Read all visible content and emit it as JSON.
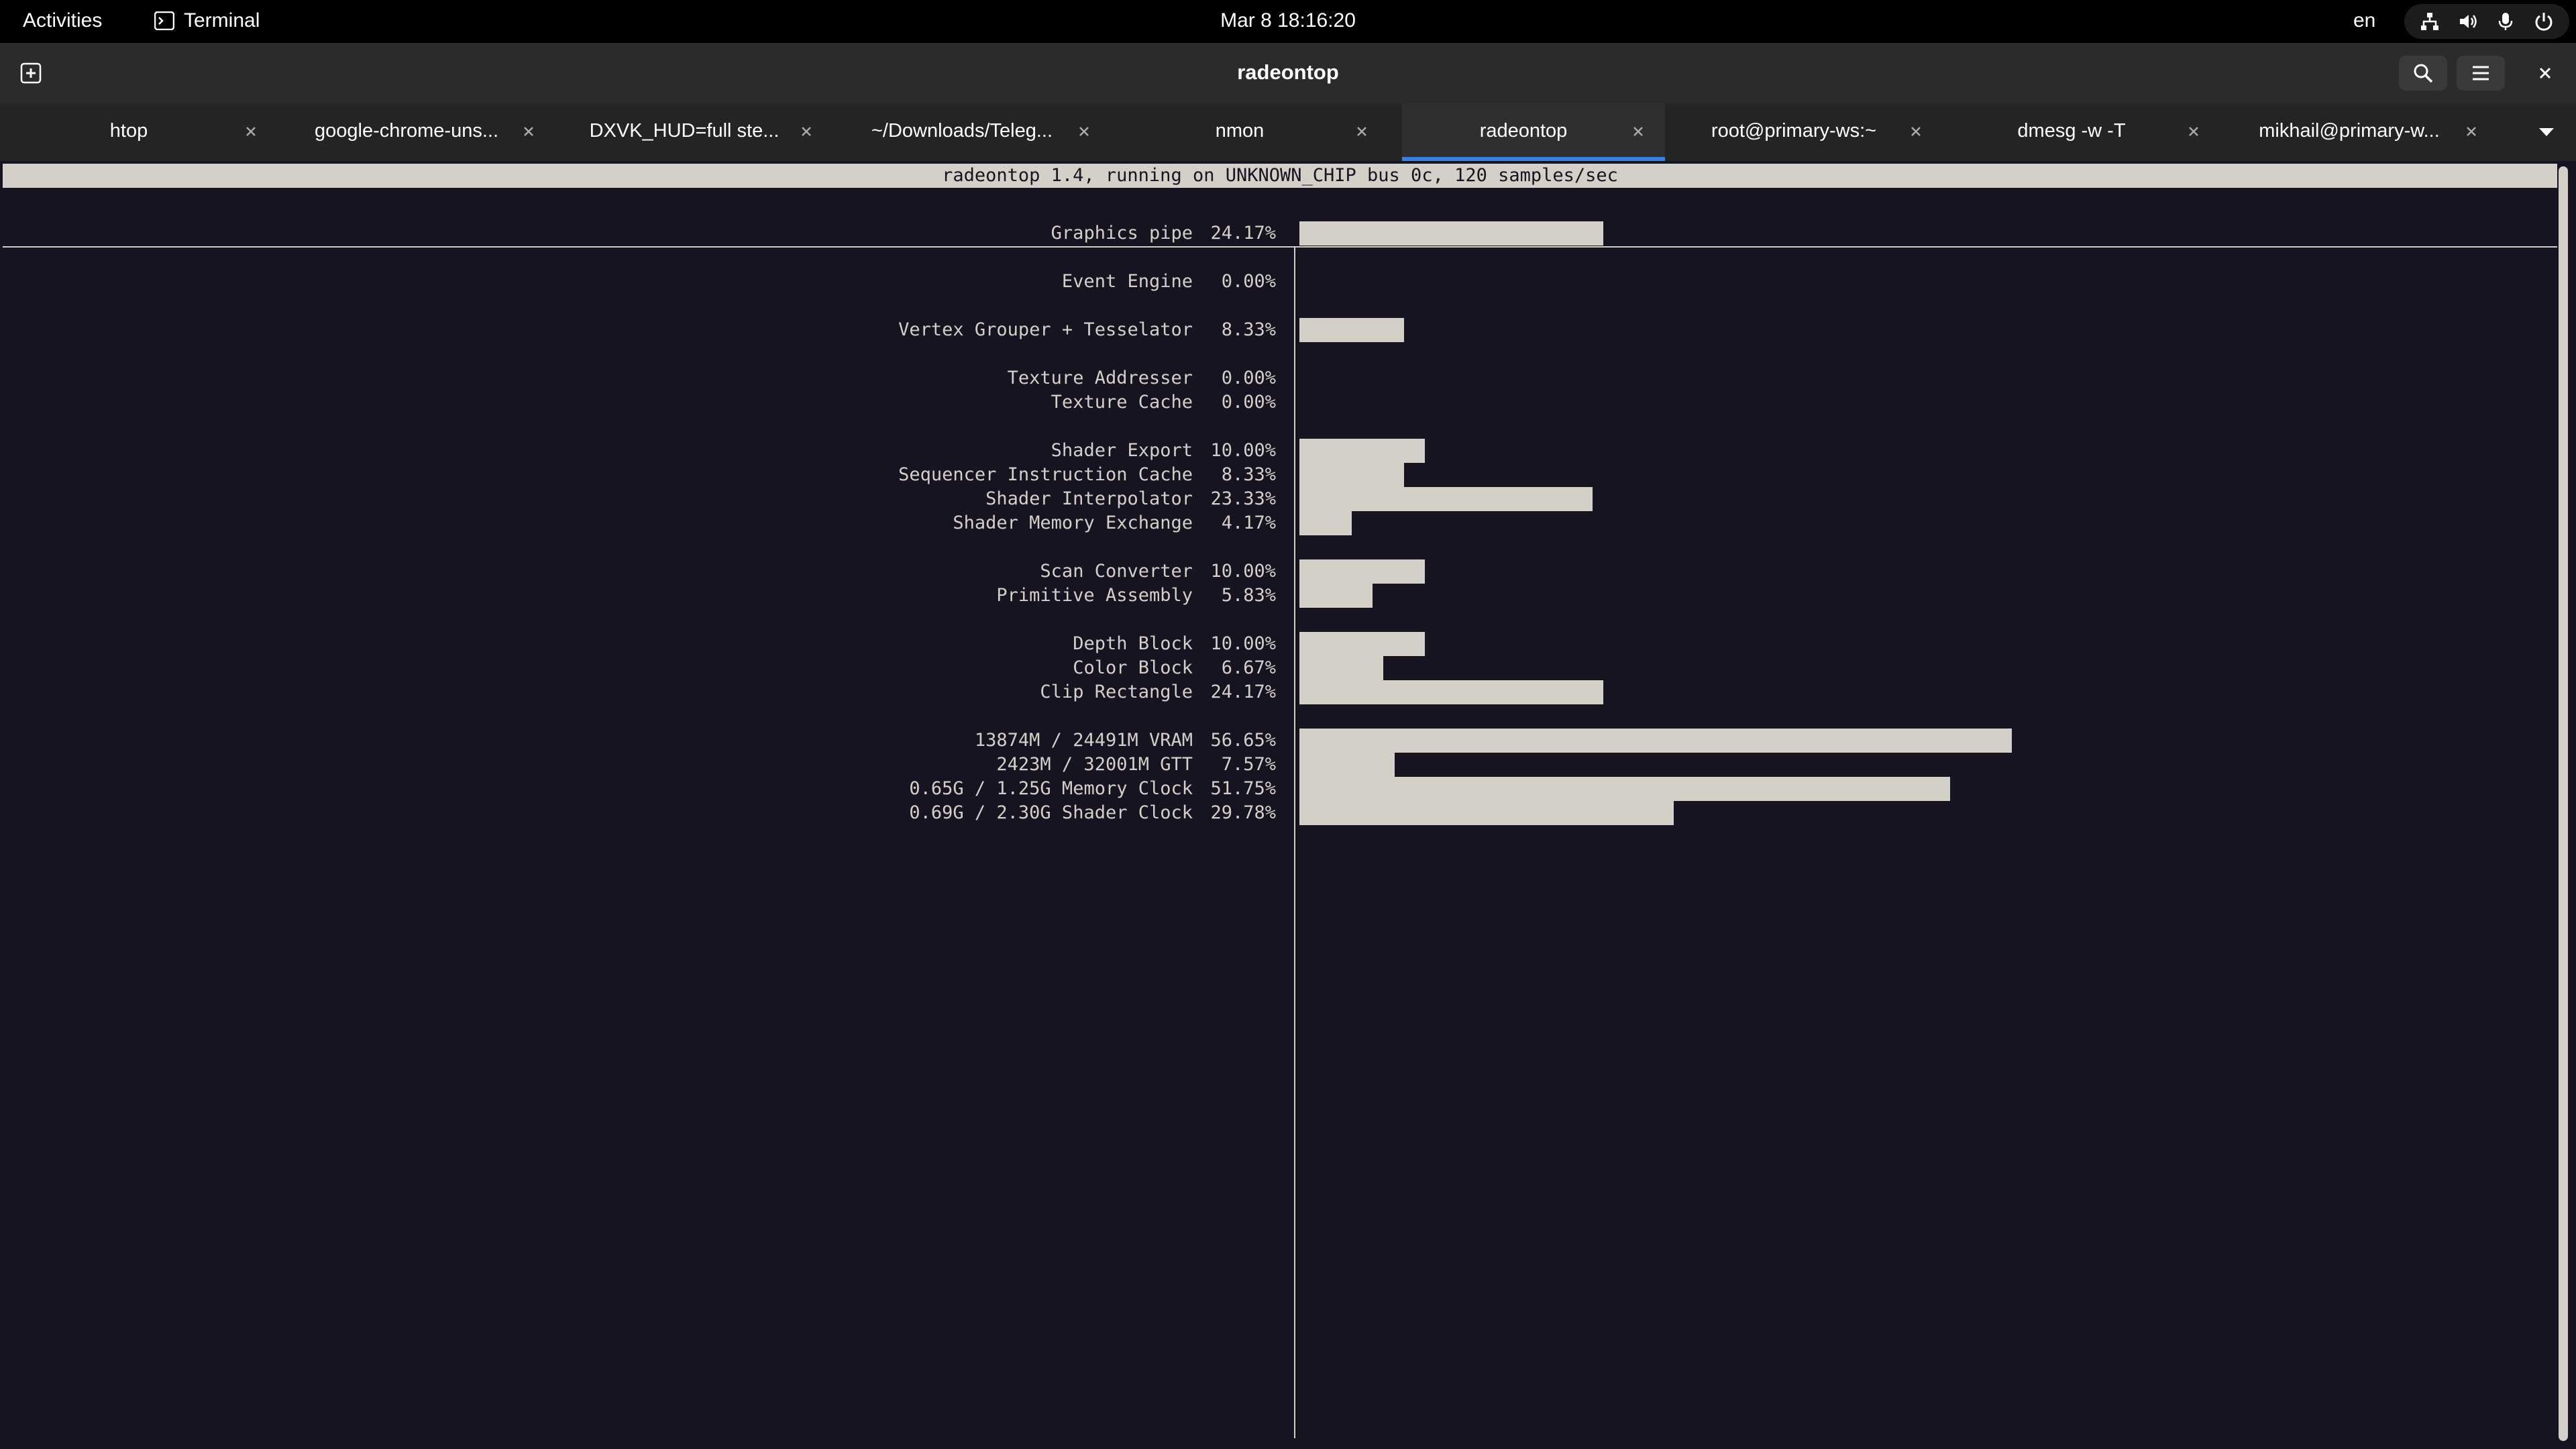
{
  "topbar": {
    "activities": "Activities",
    "app_name": "Terminal",
    "clock": "Mar 8  18:16:20",
    "language": "en",
    "status_icons": [
      "network-icon",
      "volume-icon",
      "microphone-icon",
      "power-icon"
    ]
  },
  "headerbar": {
    "title": "radeontop",
    "buttons": [
      "new-tab-icon",
      "search-icon",
      "hamburger-menu-icon",
      "close-icon"
    ]
  },
  "tabs": [
    {
      "label": "htop",
      "active": false
    },
    {
      "label": "google-chrome-uns...",
      "active": false
    },
    {
      "label": "DXVK_HUD=full ste...",
      "active": false
    },
    {
      "label": "~/Downloads/Teleg...",
      "active": false
    },
    {
      "label": "nmon",
      "active": false
    },
    {
      "label": "radeontop",
      "active": true
    },
    {
      "label": "root@primary-ws:~",
      "active": false
    },
    {
      "label": "dmesg -w -T",
      "active": false
    },
    {
      "label": "mikhail@primary-w...",
      "active": false
    }
  ],
  "terminal": {
    "header": "radeontop 1.4, running on UNKNOWN_CHIP bus 0c, 120 samples/sec",
    "colors": {
      "background": "#171421",
      "foreground": "#d3d0c8",
      "accent": "#3584e4"
    }
  },
  "chart_data": {
    "type": "bar",
    "orientation": "horizontal",
    "categories": [
      "Graphics pipe",
      "Event Engine",
      "Vertex Grouper + Tesselator",
      "Texture Addresser",
      "Texture Cache",
      "Shader Export",
      "Sequencer Instruction Cache",
      "Shader Interpolator",
      "Shader Memory Exchange",
      "Scan Converter",
      "Primitive Assembly",
      "Depth Block",
      "Color Block",
      "Clip Rectangle",
      "13874M / 24491M VRAM",
      "2423M / 32001M GTT",
      "0.65G / 1.25G Memory Clock",
      "0.69G / 2.30G Shader Clock"
    ],
    "value_labels": [
      "24.17%",
      "0.00%",
      "8.33%",
      "0.00%",
      "0.00%",
      "10.00%",
      "8.33%",
      "23.33%",
      "4.17%",
      "10.00%",
      "5.83%",
      "10.00%",
      "6.67%",
      "24.17%",
      "56.65%",
      "7.57%",
      "51.75%",
      "29.78%"
    ],
    "values": [
      24.17,
      0.0,
      8.33,
      0.0,
      0.0,
      10.0,
      8.33,
      23.33,
      4.17,
      10.0,
      5.83,
      10.0,
      6.67,
      24.17,
      56.65,
      7.57,
      51.75,
      29.78
    ],
    "xlim": [
      0,
      100
    ]
  }
}
